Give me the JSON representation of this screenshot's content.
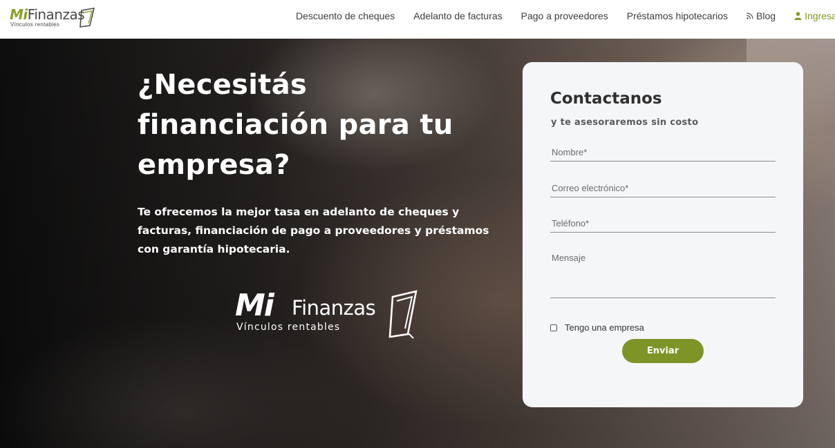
{
  "brand": {
    "logo_mi": "Mi",
    "logo_finanzas": "Finanzas",
    "tagline": "Vínculos rentables"
  },
  "nav": {
    "items": [
      {
        "label": "Descuento de cheques"
      },
      {
        "label": "Adelanto de facturas"
      },
      {
        "label": "Pago a proveedores"
      },
      {
        "label": "Préstamos hipotecarios"
      },
      {
        "label": "Blog",
        "icon": "rss-icon"
      },
      {
        "label": "Ingresar",
        "icon": "user-icon"
      }
    ]
  },
  "hero": {
    "headline_lines": [
      "¿Necesitás",
      "financiación para tu",
      "empresa?"
    ],
    "lead": "Te ofrecemos la mejor tasa en adelanto de cheques y facturas, financiación de pago a proveedores y préstamos con garantía hipotecaria.",
    "logo_mi": "Mi",
    "logo_finanzas": "Finanzas",
    "logo_tagline": "Vínculos rentables"
  },
  "contact": {
    "title": "Contactanos",
    "subtitle": "y te asesoraremos sin costo",
    "name_placeholder": "Nombre*",
    "email_placeholder": "Correo electrónico*",
    "phone_placeholder": "Teléfono*",
    "message_placeholder": "Mensaje",
    "checkbox_label": "Tengo una empresa",
    "checkbox_checked": false,
    "submit_label": "Enviar"
  },
  "colors": {
    "brand_green": "#7d9427",
    "card_bg": "#f5f6f8"
  }
}
